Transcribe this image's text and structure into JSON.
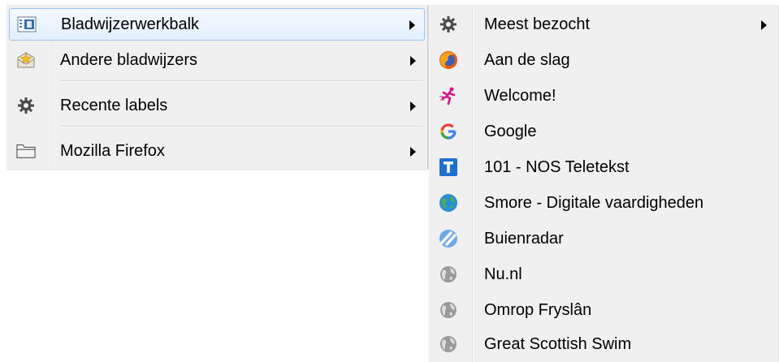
{
  "main_menu": {
    "items": [
      {
        "label": "Bladwijzerwerkbalk",
        "icon": "bookmarks-toolbar-icon"
      },
      {
        "label": "Andere bladwijzers",
        "icon": "other-bookmarks-star-icon"
      },
      {
        "label": "Recente labels",
        "icon": "gear-icon"
      },
      {
        "label": "Mozilla Firefox",
        "icon": "folder-icon"
      }
    ]
  },
  "sub_menu": {
    "items": [
      {
        "label": "Meest bezocht",
        "icon": "gear-icon"
      },
      {
        "label": "Aan de slag",
        "icon": "firefox-icon"
      },
      {
        "label": "Welcome!",
        "icon": "runner-icon"
      },
      {
        "label": "Google",
        "icon": "google-g-icon"
      },
      {
        "label": "101 - NOS Teletekst",
        "icon": "teletekst-t-icon"
      },
      {
        "label": "Smore - Digitale vaardigheden",
        "icon": "globe-blue-icon"
      },
      {
        "label": "Buienradar",
        "icon": "buienradar-icon"
      },
      {
        "label": "Nu.nl",
        "icon": "globe-gray-icon"
      },
      {
        "label": "Omrop Fryslân",
        "icon": "globe-gray-icon"
      },
      {
        "label": "Great Scottish Swim",
        "icon": "globe-gray-icon"
      }
    ]
  },
  "colors": {
    "menu_bg": "#f0f0f0",
    "highlight_border": "#9cc5f3",
    "highlight_fill": "#e3efff"
  }
}
